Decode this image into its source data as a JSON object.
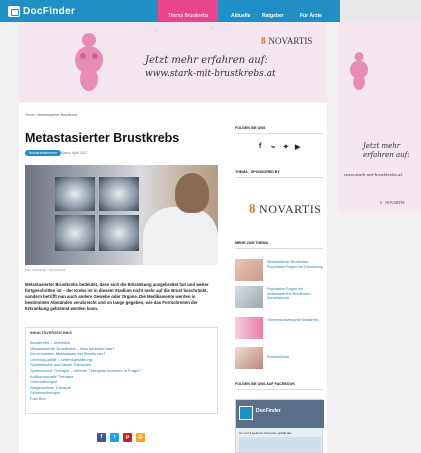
{
  "nav": {
    "logo": "DocFinder",
    "items": [
      "Thema Brustkrebs",
      "Aktuelle",
      "Ratgeber",
      "Für Ärzte"
    ]
  },
  "banner": {
    "line1": "Jetzt mehr erfahren auf:",
    "line2": "www.stark-mit-brustkrebs.at",
    "brand": "NOVARTIS"
  },
  "side_banner": {
    "line1": "Jetzt mehr erfahren auf:",
    "url": "www.stark-mit-brustkrebs.at",
    "brand": "NOVARTIS"
  },
  "article": {
    "breadcrumb": "Home › Metastasierter Brustkrebs",
    "title": "Metastasierter Brustkrebs",
    "tag": "brustkrebsthemen",
    "date": "Stand: April 2017",
    "image_credit": "Foto: DocFinder / Shutterstock",
    "intro": "Metastasierter Brustkrebs bedeutet, dass sich die Erkrankung ausgebreitet hat und weiter fortgeschritten ist – der Krebs ist in diesem Stadium nicht mehr auf die Brust beschränkt, sondern betrifft nun auch andere Gewebe oder Organe. Die Medikamente werden in bestimmten Abständen verabreicht und so lange gegeben, wie das Fortschreiten der Erkrankung gebremst werden kann.",
    "toc": {
      "title": "INHALTSVERZEICHNIS",
      "items": [
        "Brustkrebs – Überblick",
        "Metastasierter Brustkrebs – Was bedeutet das?",
        "Wo entstehen Metastasen bei Brustkrebs?",
        "Lebensqualität – Lebensgestaltung",
        "Systemische und lokale Therapien",
        "Systemische Therapie – Welche Therapien kommen in Frage?",
        "Antihormonelle Therapie",
        "Chemotherapie",
        "Zielgerichtete Therapie",
        "Schmerztherapie",
        "Fact Box"
      ]
    },
    "share": [
      {
        "icon": "facebook-icon",
        "glyph": "f",
        "color": "#3b5998"
      },
      {
        "icon": "twitter-icon",
        "glyph": "t",
        "color": "#1da1f2"
      },
      {
        "icon": "pinterest-icon",
        "glyph": "p",
        "color": "#cb2027"
      },
      {
        "icon": "email-icon",
        "glyph": "@",
        "color": "#f5a623"
      }
    ]
  },
  "rail": {
    "follow_heading": "FOLGEN SIE UNS",
    "social": [
      {
        "icon": "facebook-icon",
        "glyph": "f"
      },
      {
        "icon": "rss-icon",
        "glyph": "⌁"
      },
      {
        "icon": "twitter-icon",
        "glyph": "✦"
      },
      {
        "icon": "youtube-icon",
        "glyph": "▶"
      }
    ],
    "sponsor_heading": "THEMA - SPONSORED BY",
    "sponsor_brand": "NOVARTIS",
    "more_heading": "MEHR ZUM THEMA",
    "related": [
      "Metastasierter Brustkrebs: Psychische Folgen der Erkrankung",
      "Psychische Folgen bei metastasiertem Brustkrebs – Sprechstunde",
      "Themenschwerpunkt Brustkrebs",
      "Endometriose"
    ],
    "fb_heading": "FOLGEN SIE UNS AUF FACEBOOK",
    "fb_name": "DocFinder",
    "fb_post": "Un und 3 weiteren Freunden gefällt das"
  }
}
